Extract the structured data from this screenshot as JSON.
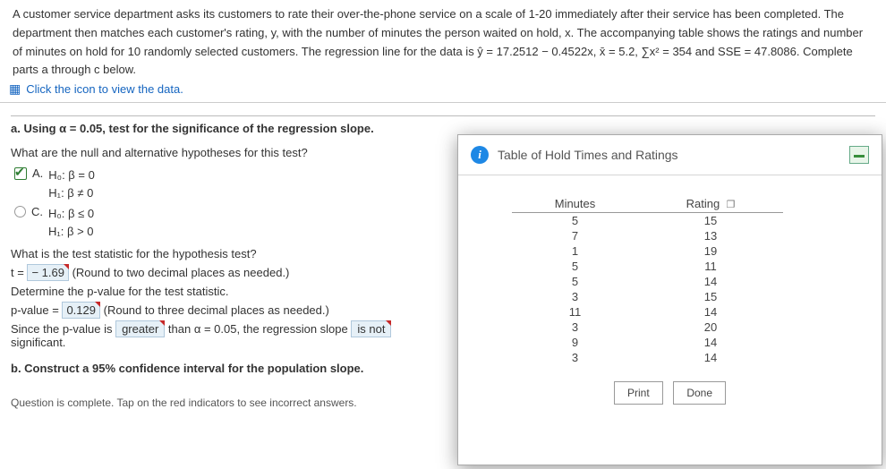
{
  "prompt": {
    "line1": "A customer service department asks its customers to rate their over-the-phone service on a scale of 1-20 immediately after their service has been completed. The",
    "line2": "department then matches each customer's rating, y, with the number of minutes the person waited on hold, x. The accompanying table shows the ratings and number",
    "line3": "of minutes on hold for 10 randomly selected customers. The regression line for the data is ŷ = 17.2512 − 0.4522x, x̄ = 5.2, ∑x² = 354 and SSE = 47.8086. Complete",
    "line4": "parts a through c below.",
    "data_link": "Click the icon to view the data."
  },
  "partA": {
    "title": "a. Using α = 0.05, test for the significance of the regression slope.",
    "hyp_question": "What are the null and alternative hypotheses for this test?",
    "choiceA": {
      "label": "A.",
      "h0": "H₀: β = 0",
      "h1": "H₁: β ≠ 0"
    },
    "choiceC": {
      "label": "C.",
      "h0": "H₀: β ≤ 0",
      "h1": "H₁: β > 0"
    },
    "tstat_q": "What is the test statistic for the hypothesis test?",
    "tstat_prefix": "t = ",
    "tstat_val": "− 1.69",
    "tstat_hint": " (Round to two decimal places as needed.)",
    "pval_q": "Determine the p-value for the test statistic.",
    "pval_prefix": "p-value = ",
    "pval_val": "0.129",
    "pval_hint": " (Round to three decimal places as needed.)",
    "concl1": "Since the p-value is ",
    "concl_drop1": "greater",
    "concl2": " than α = 0.05, the regression slope ",
    "concl_drop2": "is not",
    "concl3": " significant."
  },
  "partB": {
    "title": "b. Construct a 95% confidence interval for the population slope."
  },
  "footer": "Question is complete. Tap on the red indicators to see incorrect answers.",
  "modal": {
    "title": "Table of Hold Times and Ratings",
    "col1": "Minutes",
    "col2": "Rating",
    "rows": [
      {
        "m": "5",
        "r": "15"
      },
      {
        "m": "7",
        "r": "13"
      },
      {
        "m": "1",
        "r": "19"
      },
      {
        "m": "5",
        "r": "11"
      },
      {
        "m": "5",
        "r": "14"
      },
      {
        "m": "3",
        "r": "15"
      },
      {
        "m": "11",
        "r": "14"
      },
      {
        "m": "3",
        "r": "20"
      },
      {
        "m": "9",
        "r": "14"
      },
      {
        "m": "3",
        "r": "14"
      }
    ],
    "print": "Print",
    "done": "Done"
  }
}
